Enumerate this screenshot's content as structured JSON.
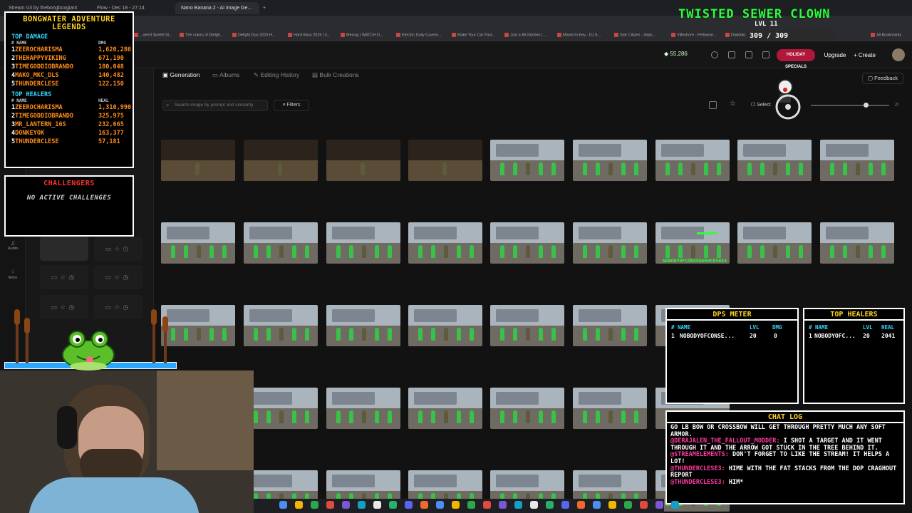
{
  "browser": {
    "tabs": [
      "Stream V3 by thebongboxgiant",
      "Flow - Dec 18 - 27:14",
      "Nano Banana 2 - AI image Ge..."
    ],
    "bookmarks": [
      "...xerrd Speed Si...",
      "The colors of Deligh...",
      "Delight Duo 2015 H...",
      "Hard Bass 2015 | ti...",
      "Merrag | WATCH D...",
      "Electric Daily Cavern...",
      "Make Your Car Fast...",
      "Just a Bit Kitchen | ...",
      "Mixed In Key - DJ S...",
      "Star Citizen - Impo...",
      "Villeshore - Fellowse...",
      "Dadolito.TO - Your N...",
      "All Bookmarks"
    ]
  },
  "header": {
    "credits": "55,286",
    "holiday": "HOLIDAY SPECIALS",
    "upgrade": "Upgrade",
    "create": "Create"
  },
  "rail": {
    "items": [
      "Audio",
      "More"
    ]
  },
  "tabs": {
    "generation": "Generation",
    "albums": "Albums",
    "editing_history": "Editing History",
    "bulk": "Bulk Creations",
    "feedback": "Feedback"
  },
  "toolbar": {
    "search_placeholder": "Search image by prompt and similarity",
    "filters": "Filters",
    "select": "Select"
  },
  "overlay": {
    "legends_title": "BONGWATER ADVENTURE LEGENDS",
    "top_damage": "TOP DAMAGE",
    "col_name": "# NAME",
    "col_dmg": "DMG",
    "damage": [
      {
        "rank": "1",
        "name": "ZEEROCHARISMA",
        "value": "1,620,286"
      },
      {
        "rank": "2",
        "name": "THEHAPPYVIKING",
        "value": "671,190"
      },
      {
        "rank": "3",
        "name": "TIMEGODDIOBRANDO",
        "value": "180,048"
      },
      {
        "rank": "4",
        "name": "MAKO_MKC_DLS",
        "value": "140,482"
      },
      {
        "rank": "5",
        "name": "THUNDERCLESE",
        "value": "122,150"
      }
    ],
    "top_healers": "TOP HEALERS",
    "col_heal": "HEAL",
    "heal": [
      {
        "rank": "1",
        "name": "ZEEROCHARISMA",
        "value": "1,310,990"
      },
      {
        "rank": "2",
        "name": "TIMEGODDIOBRANDO",
        "value": "325,975"
      },
      {
        "rank": "3",
        "name": "MR_LANTERN_16S",
        "value": "232,665"
      },
      {
        "rank": "4",
        "name": "DONKEYOK",
        "value": "163,377"
      },
      {
        "rank": "5",
        "name": "THUNDERCLESE",
        "value": "57,181"
      }
    ],
    "challenges_title": "CHALLENGERS",
    "challenges_body": "NO ACTIVE CHALLENGES",
    "clown_title": "TWISTED SEWER CLOWN",
    "clown_level": "LVL 11",
    "clown_hp": "309 / 309",
    "dps_title": "DPS METER",
    "dps_cols": [
      "# NAME",
      "LVL",
      "DMG"
    ],
    "dps_row": {
      "rank": "1",
      "name": "NOBODYOFCONSE...",
      "lvl": "20",
      "dmg": "0"
    },
    "th_title": "TOP HEALERS",
    "th_cols": [
      "# NAME",
      "LVL",
      "HEAL"
    ],
    "th_row": {
      "rank": "1",
      "name": "NOBODYOFC...",
      "lvl": "20",
      "heal": "2041"
    },
    "player_tag": "NOBODYOFCONSEQUENCE5654",
    "chat_title": "CHAT LOG",
    "chat": [
      {
        "user": "",
        "text": "GO LB BOW OR CROSSBOW WILL GET THROUGH PRETTY MUCH ANY SOFT ARMOR."
      },
      {
        "user": "@DERAJALEN_THE_FALLOUT_MODDER:",
        "text": " I SHOT A TARGET AND IT WENT THROUGH IT AND THE ARROW GOT STUCK IN THE TREE BEHIND IT."
      },
      {
        "user": "@STREAMELEMENTS:",
        "text": " DON'T FORGET TO LIKE THE STREAM! IT HELPS A LOT!"
      },
      {
        "user": "@THUNDERCLESE3:",
        "text": " HIME WITH THE FAT STACKS FROM THE DOP CRAGHOUT REPORT"
      },
      {
        "user": "@THUNDERCLESE3:",
        "text": " HIM*"
      }
    ]
  },
  "colors": {
    "accent": "#2bff3a",
    "gold": "#ffd21e",
    "cyan": "#34d7ff",
    "orange": "#ff8c1a",
    "pink": "#ff3aa0"
  }
}
